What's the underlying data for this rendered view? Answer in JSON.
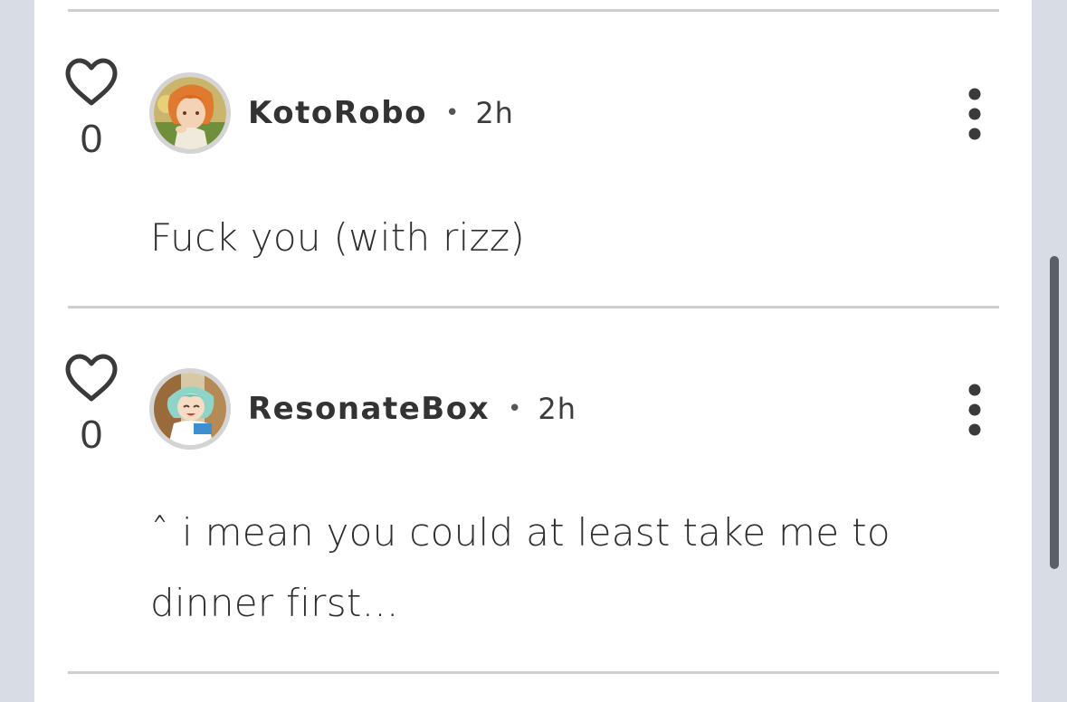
{
  "comments": [
    {
      "likes": "0",
      "username": "KotoRobo",
      "separator": "•",
      "time": "2h",
      "body": "Fuck you (with rizz)"
    },
    {
      "likes": "0",
      "username": "ResonateBox",
      "separator": "•",
      "time": "2h",
      "body": "ˆ i mean you could at least take me to dinner first..."
    }
  ],
  "icons": {
    "like": "heart-outline-icon",
    "more": "vertical-ellipsis-icon"
  },
  "colors": {
    "page_background": "#d7dce5",
    "card_background": "#ffffff",
    "divider": "#cfcfcf",
    "text": "#2e2e2e",
    "scrollbar": "#5b5f66"
  }
}
